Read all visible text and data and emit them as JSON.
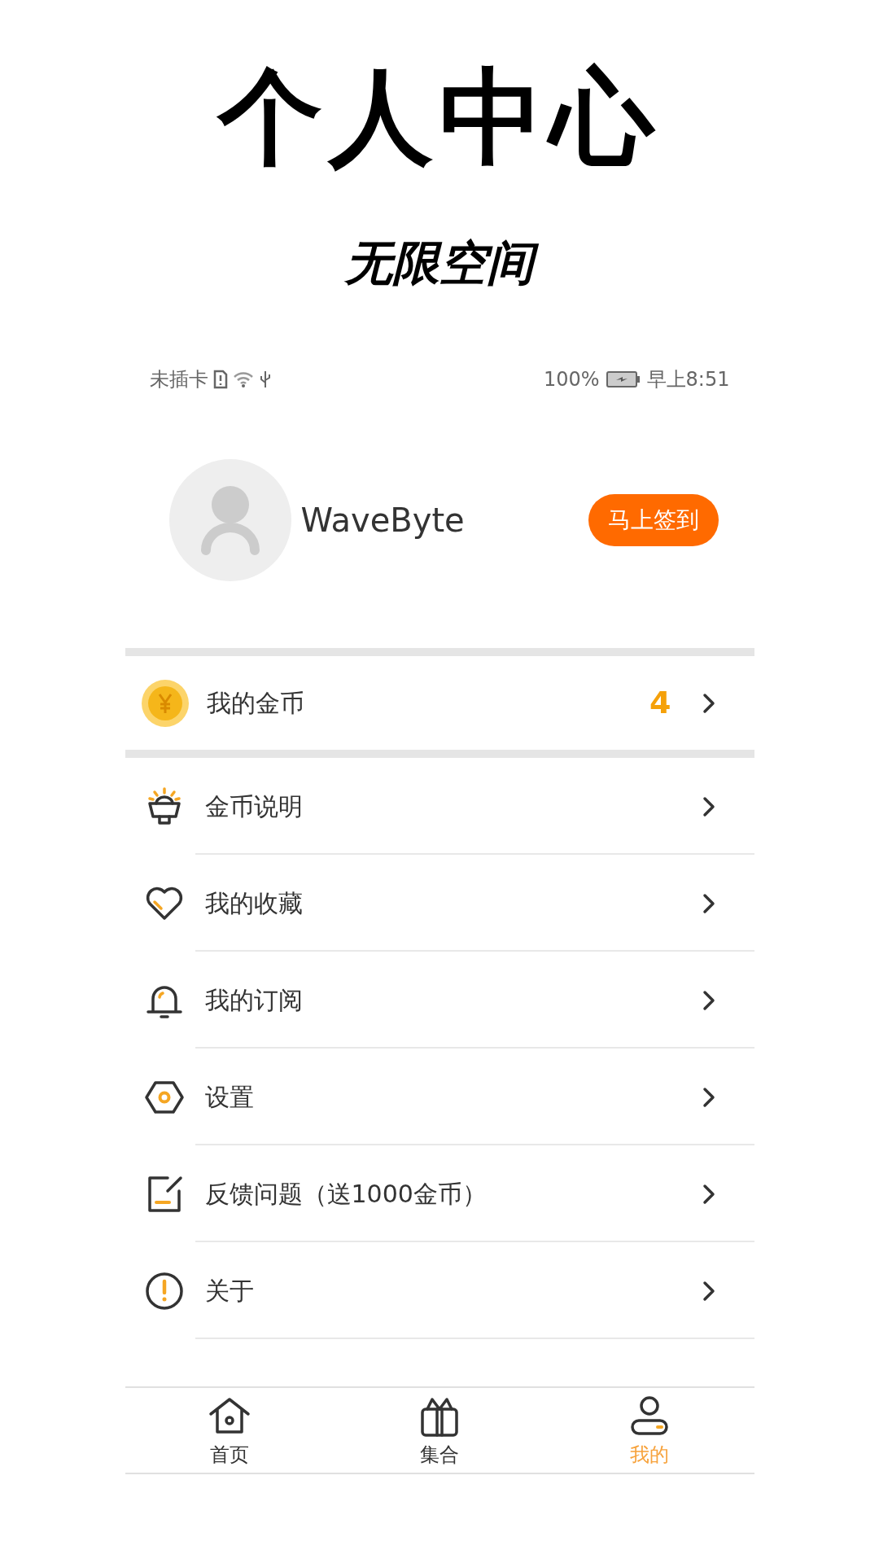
{
  "headline": {
    "title": "个人中心",
    "subtitle": "无限空间"
  },
  "status_bar": {
    "carrier": "未插卡",
    "battery": "100%",
    "time": "早上8:51"
  },
  "profile": {
    "username": "WaveByte",
    "checkin_button": "马上签到"
  },
  "coins": {
    "label": "我的金币",
    "count": "4"
  },
  "menu": [
    {
      "kind": "lamp",
      "label": "金币说明"
    },
    {
      "kind": "heart",
      "label": "我的收藏"
    },
    {
      "kind": "bell",
      "label": "我的订阅"
    },
    {
      "kind": "settings",
      "label": "设置"
    },
    {
      "kind": "note",
      "label": "反馈问题（送1000金币）"
    },
    {
      "kind": "info",
      "label": "关于"
    }
  ],
  "tabs": [
    {
      "kind": "home",
      "label": "首页",
      "selected": false
    },
    {
      "kind": "gift",
      "label": "集合",
      "selected": false
    },
    {
      "kind": "user",
      "label": "我的",
      "selected": true
    }
  ]
}
